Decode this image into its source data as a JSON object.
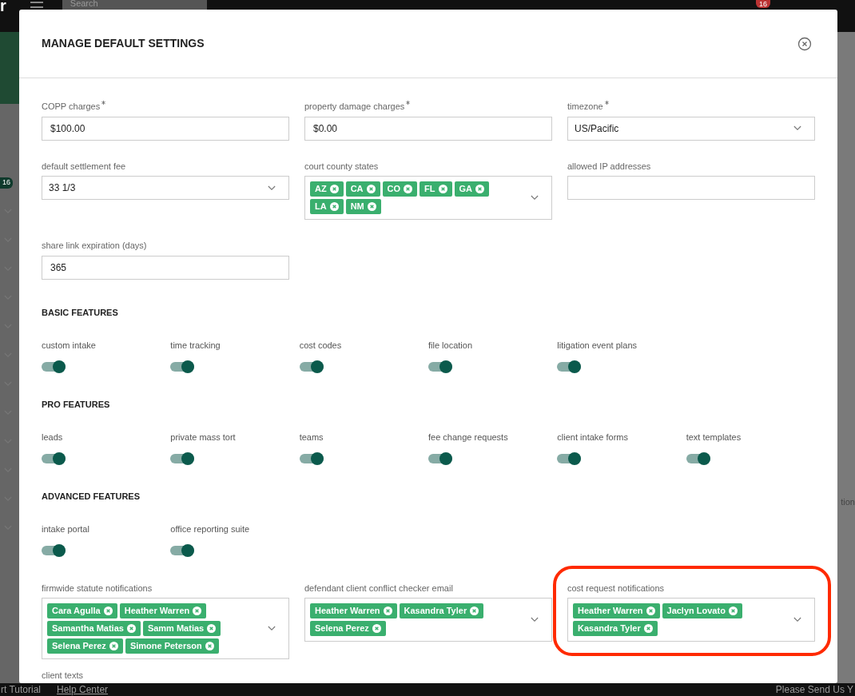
{
  "app_background": {
    "logo_fragment": "r",
    "search_placeholder": "Search",
    "notification_count": "16",
    "sidebar_badge": "16",
    "side_text": "tion",
    "footer_links": [
      "rt Tutorial",
      "Help Center"
    ],
    "footer_message": "Please Send Us Y"
  },
  "modal": {
    "title": "MANAGE DEFAULT SETTINGS",
    "fields": [
      {
        "kind": "text",
        "label": "COPP charges",
        "required": true,
        "value": "$100.00"
      },
      {
        "kind": "text",
        "label": "property damage charges",
        "required": true,
        "value": "$0.00"
      },
      {
        "kind": "select",
        "label": "timezone",
        "required": true,
        "value": "US/Pacific"
      },
      {
        "kind": "select",
        "label": "default settlement fee",
        "required": false,
        "value": "33 1/3"
      },
      {
        "kind": "tags",
        "label": "court county states",
        "required": false,
        "tags": [
          "AZ",
          "CA",
          "CO",
          "FL",
          "GA",
          "LA",
          "NM"
        ]
      },
      {
        "kind": "text",
        "label": "allowed IP addresses",
        "required": false
      },
      {
        "kind": "text",
        "label": "share link expiration (days)",
        "required": false,
        "value": "365"
      }
    ],
    "sections": [
      {
        "title": "BASIC FEATURES",
        "toggles": [
          {
            "label": "custom intake",
            "on": true
          },
          {
            "label": "time tracking",
            "on": true
          },
          {
            "label": "cost codes",
            "on": true
          },
          {
            "label": "file location",
            "on": true
          },
          {
            "label": "litigation event plans",
            "on": true
          }
        ]
      },
      {
        "title": "PRO FEATURES",
        "toggles": [
          {
            "label": "leads",
            "on": true
          },
          {
            "label": "private mass tort",
            "on": true
          },
          {
            "label": "teams",
            "on": true
          },
          {
            "label": "fee change requests",
            "on": true
          },
          {
            "label": "client intake forms",
            "on": true
          },
          {
            "label": "text templates",
            "on": true
          }
        ]
      },
      {
        "title": "ADVANCED FEATURES",
        "toggles": [
          {
            "label": "intake portal",
            "on": true
          },
          {
            "label": "office reporting suite",
            "on": true
          }
        ]
      }
    ],
    "notification_fields": [
      {
        "kind": "tags",
        "label": "firmwide statute notifications",
        "highlighted": false,
        "tags": [
          "Cara Agulla",
          "Heather Warren",
          "Samantha Matias",
          "Samm Matias",
          "Selena Perez",
          "Simone Peterson"
        ]
      },
      {
        "kind": "tags",
        "label": "defendant client conflict checker email",
        "highlighted": false,
        "tags": [
          "Heather Warren",
          "Kasandra Tyler",
          "Selena Perez"
        ]
      },
      {
        "kind": "tags",
        "label": "cost request notifications",
        "highlighted": true,
        "tags": [
          "Heather Warren",
          "Jaclyn Lovato",
          "Kasandra Tyler"
        ]
      }
    ],
    "next_label": "client texts"
  }
}
